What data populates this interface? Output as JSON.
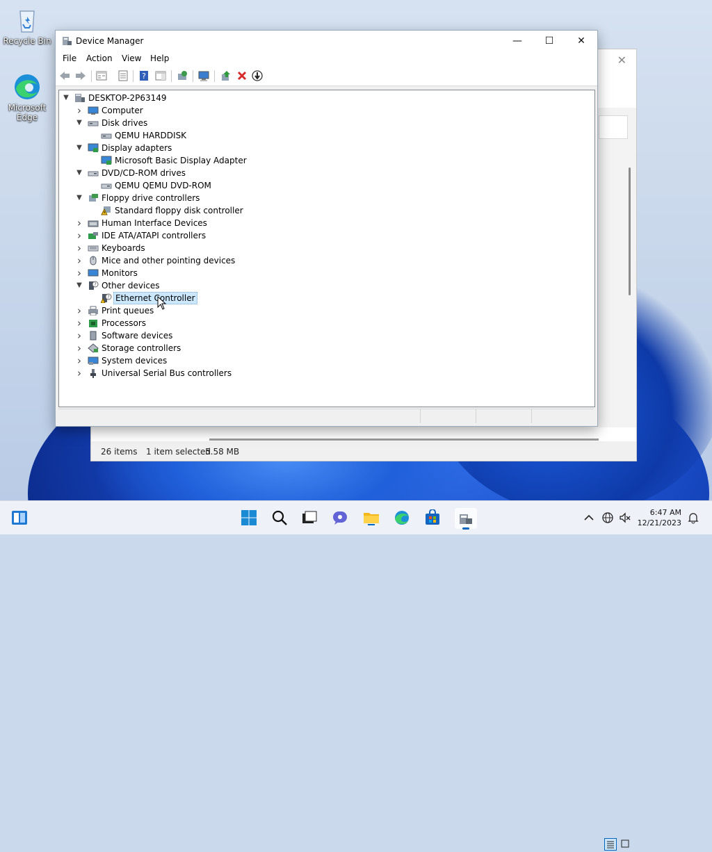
{
  "desktop": {
    "icons": [
      {
        "label": "Recycle Bin"
      },
      {
        "label": "Microsoft Edge"
      }
    ]
  },
  "explorer": {
    "status_items": "26 items",
    "status_selected": "1 item selected",
    "status_size": "5.58 MB"
  },
  "window": {
    "title": "Device Manager",
    "menu": [
      "File",
      "Action",
      "View",
      "Help"
    ]
  },
  "tree": {
    "root": "DESKTOP-2P63149",
    "nodes": [
      {
        "label": "Computer",
        "level": 1,
        "state": "collapsed",
        "icon": "computer-icon"
      },
      {
        "label": "Disk drives",
        "level": 1,
        "state": "expanded",
        "icon": "disk-drive-icon"
      },
      {
        "label": "QEMU HARDDISK",
        "level": 2,
        "state": "leaf",
        "icon": "disk-drive-icon"
      },
      {
        "label": "Display adapters",
        "level": 1,
        "state": "expanded",
        "icon": "display-adapter-icon"
      },
      {
        "label": "Microsoft Basic Display Adapter",
        "level": 2,
        "state": "leaf",
        "icon": "display-adapter-icon"
      },
      {
        "label": "DVD/CD-ROM drives",
        "level": 1,
        "state": "expanded",
        "icon": "dvd-drive-icon"
      },
      {
        "label": "QEMU QEMU DVD-ROM",
        "level": 2,
        "state": "leaf",
        "icon": "dvd-drive-icon"
      },
      {
        "label": "Floppy drive controllers",
        "level": 1,
        "state": "expanded",
        "icon": "floppy-controller-icon"
      },
      {
        "label": "Standard floppy disk controller",
        "level": 2,
        "state": "leaf",
        "icon": "floppy-warning-icon"
      },
      {
        "label": "Human Interface Devices",
        "level": 1,
        "state": "collapsed",
        "icon": "hid-icon"
      },
      {
        "label": "IDE ATA/ATAPI controllers",
        "level": 1,
        "state": "collapsed",
        "icon": "ide-controller-icon"
      },
      {
        "label": "Keyboards",
        "level": 1,
        "state": "collapsed",
        "icon": "keyboard-icon"
      },
      {
        "label": "Mice and other pointing devices",
        "level": 1,
        "state": "collapsed",
        "icon": "mouse-icon"
      },
      {
        "label": "Monitors",
        "level": 1,
        "state": "collapsed",
        "icon": "monitor-icon"
      },
      {
        "label": "Other devices",
        "level": 1,
        "state": "expanded",
        "icon": "unknown-device-icon"
      },
      {
        "label": "Ethernet Controller",
        "level": 2,
        "state": "leaf",
        "icon": "unknown-device-warning-icon",
        "selected": true
      },
      {
        "label": "Print queues",
        "level": 1,
        "state": "collapsed",
        "icon": "printer-icon"
      },
      {
        "label": "Processors",
        "level": 1,
        "state": "collapsed",
        "icon": "processor-icon"
      },
      {
        "label": "Software devices",
        "level": 1,
        "state": "collapsed",
        "icon": "software-device-icon"
      },
      {
        "label": "Storage controllers",
        "level": 1,
        "state": "collapsed",
        "icon": "storage-controller-icon"
      },
      {
        "label": "System devices",
        "level": 1,
        "state": "collapsed",
        "icon": "system-devices-icon"
      },
      {
        "label": "Universal Serial Bus controllers",
        "level": 1,
        "state": "collapsed",
        "icon": "usb-icon"
      }
    ]
  },
  "taskbar": {
    "time": "6:47 AM",
    "date": "12/21/2023"
  },
  "colors": {
    "selection": "#cce8ff",
    "accent": "#0067c0"
  }
}
